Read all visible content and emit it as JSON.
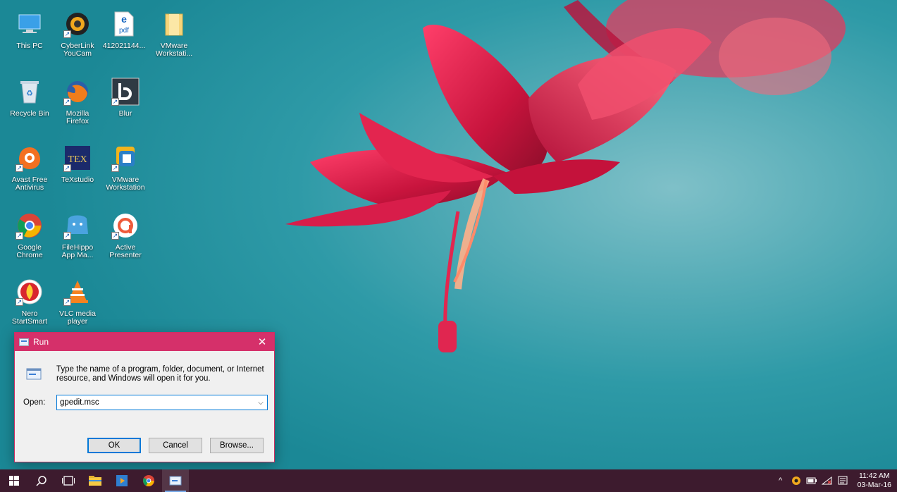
{
  "desktop": {
    "icons": [
      {
        "label": "This PC",
        "icon": "this-pc-icon"
      },
      {
        "label": "CyberLink\nYouCam",
        "icon": "cyberlink-youcam-icon"
      },
      {
        "label": "412021144...",
        "icon": "pdf-file-icon"
      },
      {
        "label": "VMware\nWorkstati...",
        "icon": "folder-icon"
      },
      {
        "label": "Recycle Bin",
        "icon": "recycle-bin-icon"
      },
      {
        "label": "Mozilla\nFirefox",
        "icon": "firefox-icon"
      },
      {
        "label": "Blur",
        "icon": "blur-icon"
      },
      {
        "label": "Avast Free\nAntivirus",
        "icon": "avast-icon"
      },
      {
        "label": "TeXstudio",
        "icon": "texstudio-icon"
      },
      {
        "label": "VMware\nWorkstation",
        "icon": "vmware-icon"
      },
      {
        "label": "Google\nChrome",
        "icon": "chrome-icon"
      },
      {
        "label": "FileHippo\nApp Ma...",
        "icon": "filehippo-icon"
      },
      {
        "label": "Active\nPresenter",
        "icon": "activepresenter-icon"
      },
      {
        "label": "Nero\nStartSmart",
        "icon": "nero-icon"
      },
      {
        "label": "VLC media\nplayer",
        "icon": "vlc-icon"
      }
    ]
  },
  "run_dialog": {
    "title": "Run",
    "close_glyph": "✕",
    "description": "Type the name of a program, folder, document, or Internet resource, and Windows will open it for you.",
    "open_label": "Open:",
    "open_value": "gpedit.msc",
    "dropdown_glyph": "⌵",
    "buttons": {
      "ok": "OK",
      "cancel": "Cancel",
      "browse": "Browse..."
    }
  },
  "taskbar": {
    "clock_time": "11:42 AM",
    "clock_date": "03-Mar-16",
    "tray_chevron": "^"
  },
  "colors": {
    "accent": "#d5306a",
    "taskbar": "#3d1b2e",
    "focus_blue": "#0078d7"
  }
}
